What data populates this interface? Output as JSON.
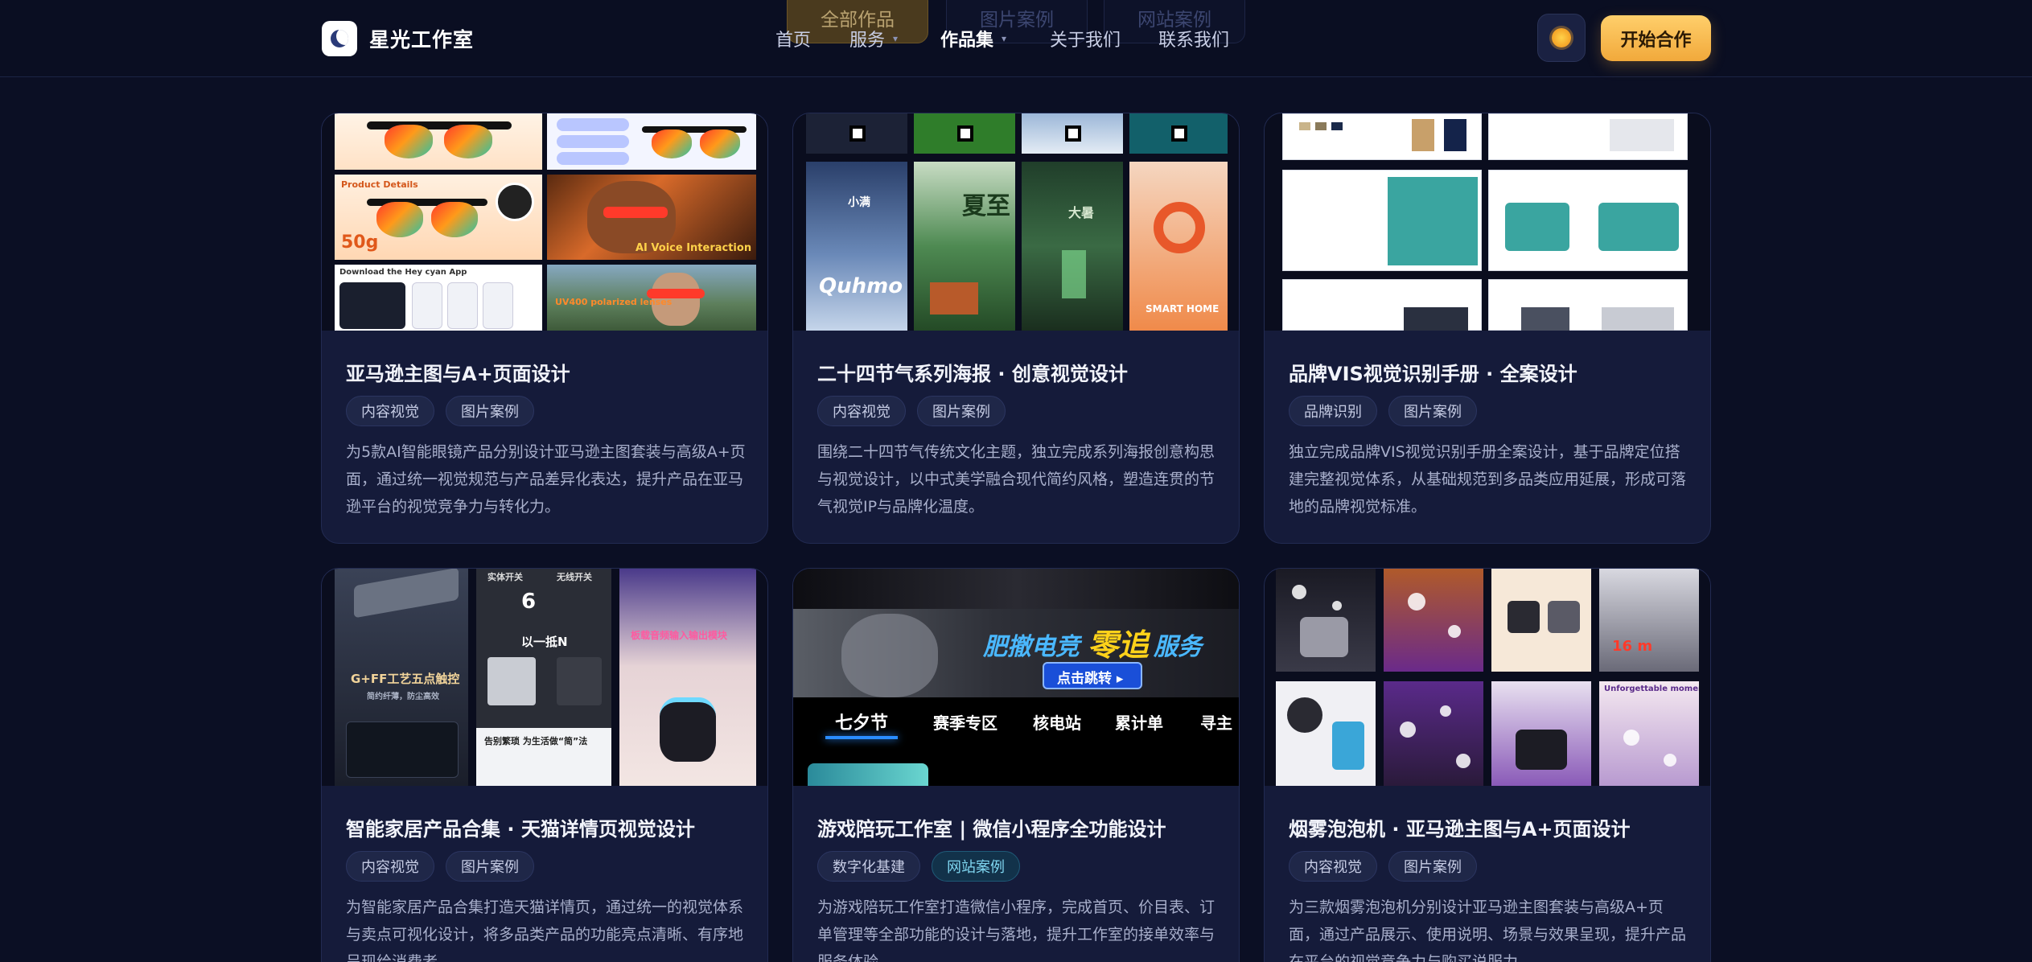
{
  "header": {
    "brand": "星光工作室",
    "filters": [
      "全部作品",
      "图片案例",
      "网站案例"
    ],
    "nav": [
      {
        "label": "首页",
        "dropdown": false
      },
      {
        "label": "服务",
        "dropdown": true
      },
      {
        "label": "作品集",
        "dropdown": true,
        "current": true
      },
      {
        "label": "关于我们",
        "dropdown": false
      },
      {
        "label": "联系我们",
        "dropdown": false
      }
    ],
    "theme_icon": "sun-icon",
    "cta_label": "开始合作"
  },
  "colors": {
    "background": "#0b0f24",
    "card": "#151b3a",
    "accent": "#f1a93b",
    "web_tag": "#7fd6f0"
  },
  "cards": [
    {
      "title": "亚马逊主图与A+页面设计",
      "tags": [
        "内容视觉",
        "图片案例"
      ],
      "desc": "为5款AI智能眼镜产品分别设计亚马逊主图套装与高级A+页面，通过统一视觉规范与产品差异化表达，提升产品在亚马逊平台的视觉竞争力与转化力。",
      "thumb": {
        "product_details": "Product Details",
        "weight": "50g",
        "ai_voice": "AI Voice Interaction",
        "download": "Download the Hey cyan App",
        "uv": "UV400 polarized lenses"
      }
    },
    {
      "title": "二十四节气系列海报 · 创意视觉设计",
      "tags": [
        "内容视觉",
        "图片案例"
      ],
      "desc": "围绕二十四节气传统文化主题，独立完成系列海报创意构思与视觉设计，以中式美学融合现代简约风格，塑造连贯的节气视觉IP与品牌化温度。",
      "thumb": {
        "logo": "Quhmo",
        "poster_a": "小满",
        "poster_b": "夏至",
        "poster_c": "大暑",
        "smart_home": "SMART HOME"
      }
    },
    {
      "title": "品牌VIS视觉识别手册 · 全案设计",
      "tags": [
        "品牌识别",
        "图片案例"
      ],
      "desc": "独立完成品牌VIS视觉识别手册全案设计，基于品牌定位搭建完整视觉体系，从基础规范到多品类应用延展，形成可落地的品牌视觉标准。",
      "thumb": {}
    },
    {
      "title": "智能家居产品合集 · 天猫详情页视觉设计",
      "tags": [
        "内容视觉",
        "图片案例"
      ],
      "desc": "为智能家居产品合集打造天猫详情页，通过统一的视觉体系与卖点可视化设计，将多品类产品的功能亮点清晰、有序地呈现给消费者。",
      "thumb": {
        "panel_text": "G+FF工艺五点触控",
        "panel_sub": "简约纤薄，防尘高效",
        "switch_a": "实体开关",
        "switch_b": "无线开关",
        "six": "6",
        "one_n": "以一抵N",
        "scene": "告别繁琐 为生活做“简”法",
        "audio": "板载音频输入输出模块"
      }
    },
    {
      "title": "游戏陪玩工作室 | 微信小程序全功能设计",
      "tags": [
        "数字化基建",
        "网站案例"
      ],
      "desc": "为游戏陪玩工作室打造微信小程序，完成首页、价目表、订单管理等全部功能的设计与落地，提升工作室的接单效率与服务体验。",
      "thumb": {
        "banner_a": "肥撤电竞",
        "banner_b": "零追",
        "banner_c": "服务",
        "jump": "点击跳转 ▸",
        "tabs": [
          "七夕节",
          "赛季专区",
          "核电站",
          "累计单",
          "寻主"
        ]
      }
    },
    {
      "title": "烟雾泡泡机 · 亚马逊主图与A+页面设计",
      "tags": [
        "内容视觉",
        "图片案例"
      ],
      "desc": "为三款烟雾泡泡机分别设计亚马逊主图套装与高级A+页面，通过产品展示、使用说明、场景与效果呈现，提升产品在平台的视觉竞争力与购买说服力。",
      "thumb": {
        "fog": "16 m",
        "party": "Unforgettable moments"
      }
    }
  ]
}
